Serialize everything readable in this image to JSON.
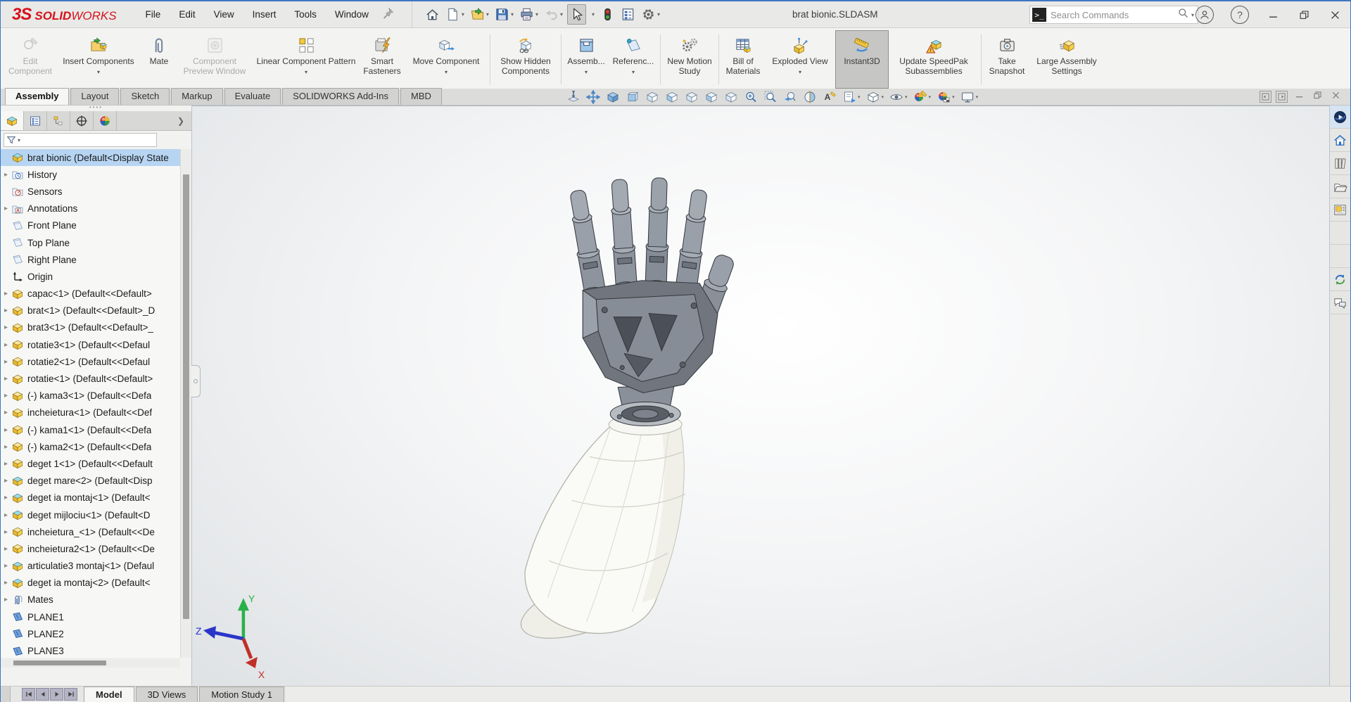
{
  "window": {
    "logo": "3S",
    "brand_bold": "SOLID",
    "brand_rest": "WORKS",
    "title": "brat bionic.SLDASM"
  },
  "menu": {
    "items": [
      "File",
      "Edit",
      "View",
      "Insert",
      "Tools",
      "Window"
    ]
  },
  "search": {
    "placeholder": "Search Commands"
  },
  "ribbon": {
    "buttons": [
      {
        "label": "Edit Component"
      },
      {
        "label": "Insert Components"
      },
      {
        "label": "Mate"
      },
      {
        "label": "Component Preview Window"
      },
      {
        "label": "Linear Component Pattern"
      },
      {
        "label": "Smart Fasteners"
      },
      {
        "label": "Move Component"
      },
      {
        "label": "Show Hidden Components"
      },
      {
        "label": "Assemb..."
      },
      {
        "label": "Referenc..."
      },
      {
        "label": "New Motion Study"
      },
      {
        "label": "Bill of Materials"
      },
      {
        "label": "Exploded View"
      },
      {
        "label": "Instant3D"
      },
      {
        "label": "Update SpeedPak Subassemblies"
      },
      {
        "label": "Take Snapshot"
      },
      {
        "label": "Large Assembly Settings"
      }
    ]
  },
  "tabs": {
    "items": [
      {
        "label": "Assembly",
        "active": true,
        "name": "tab-assembly"
      },
      {
        "label": "Layout",
        "name": "tab-layout"
      },
      {
        "label": "Sketch",
        "name": "tab-sketch"
      },
      {
        "label": "Markup",
        "name": "tab-markup"
      },
      {
        "label": "Evaluate",
        "name": "tab-evaluate"
      },
      {
        "label": "SOLIDWORKS Add-Ins",
        "name": "tab-solidworks-add-ins"
      },
      {
        "label": "MBD",
        "name": "tab-mbd"
      }
    ]
  },
  "hud": {
    "items": [
      {
        "name": "zoom-to-fit-button",
        "icon": "hud-fit"
      },
      {
        "name": "pan-button",
        "icon": "hud-pan"
      },
      {
        "name": "view-isometric-button",
        "icon": "hud-cube-solid"
      },
      {
        "name": "view-front-button",
        "icon": "hud-cube-front"
      },
      {
        "name": "view-back-button",
        "icon": "hud-cube"
      },
      {
        "name": "view-left-button",
        "icon": "hud-cube-left"
      },
      {
        "name": "view-right-button",
        "icon": "hud-cube"
      },
      {
        "name": "view-top-button",
        "icon": "hud-cube-left"
      },
      {
        "name": "view-bottom-button",
        "icon": "hud-cube"
      },
      {
        "name": "zoom-to-area-button",
        "icon": "hud-zoom-area"
      },
      {
        "name": "zoom-in-out-button",
        "icon": "hud-zoom"
      },
      {
        "name": "previous-view-button",
        "icon": "hud-prev"
      },
      {
        "name": "section-view-button",
        "icon": "hud-section"
      },
      {
        "name": "annotation-visibility-button",
        "icon": "hud-anno"
      },
      {
        "name": "view-orientation-button",
        "icon": "hud-sheet",
        "caret": true
      },
      {
        "name": "display-style-button",
        "icon": "hud-cube-outline",
        "caret": true
      },
      {
        "name": "hide-show-items-button",
        "icon": "hud-eye",
        "caret": true
      },
      {
        "name": "edit-appearance-button",
        "icon": "hud-ball-pencil",
        "caret": true
      },
      {
        "name": "apply-scene-button",
        "icon": "hud-ball-scene",
        "caret": true
      },
      {
        "name": "view-settings-button",
        "icon": "hud-monitor",
        "caret": true
      }
    ]
  },
  "tree": {
    "items": [
      {
        "label": "brat bionic  (Default<Display State",
        "icon": "i-asm",
        "selected": true,
        "name": "tree-item-root"
      },
      {
        "label": "History",
        "icon": "i-folder-history",
        "arrow": true
      },
      {
        "label": "Sensors",
        "icon": "i-folder-sensors"
      },
      {
        "label": "Annotations",
        "icon": "i-folder-annotations",
        "arrow": true
      },
      {
        "label": "Front Plane",
        "icon": "i-plane"
      },
      {
        "label": "Top Plane",
        "icon": "i-plane"
      },
      {
        "label": "Right Plane",
        "icon": "i-plane"
      },
      {
        "label": "Origin",
        "icon": "i-origin"
      },
      {
        "label": "capac<1> (Default<<Default>",
        "icon": "i-part",
        "arrow": true
      },
      {
        "label": "brat<1> (Default<<Default>_D",
        "icon": "i-part",
        "arrow": true
      },
      {
        "label": "brat3<1> (Default<<Default>_",
        "icon": "i-part",
        "arrow": true
      },
      {
        "label": "rotatie3<1> (Default<<Defaul",
        "icon": "i-part",
        "arrow": true
      },
      {
        "label": "rotatie2<1> (Default<<Defaul",
        "icon": "i-part",
        "arrow": true
      },
      {
        "label": "rotatie<1> (Default<<Default>",
        "icon": "i-part",
        "arrow": true
      },
      {
        "label": "(-) kama3<1> (Default<<Defa",
        "icon": "i-part",
        "arrow": true
      },
      {
        "label": "incheietura<1> (Default<<Def",
        "icon": "i-part",
        "arrow": true
      },
      {
        "label": "(-) kama1<1> (Default<<Defa",
        "icon": "i-part",
        "arrow": true
      },
      {
        "label": "(-) kama2<1> (Default<<Defa",
        "icon": "i-part",
        "arrow": true
      },
      {
        "label": "deget 1<1> (Default<<Default",
        "icon": "i-part",
        "arrow": true
      },
      {
        "label": "deget mare<2> (Default<Disp",
        "icon": "i-asm",
        "arrow": true
      },
      {
        "label": "deget ia montaj<1> (Default<",
        "icon": "i-asm",
        "arrow": true
      },
      {
        "label": "deget mijlociu<1> (Default<D",
        "icon": "i-asm",
        "arrow": true
      },
      {
        "label": "incheietura_<1> (Default<<De",
        "icon": "i-part",
        "arrow": true
      },
      {
        "label": "incheietura2<1> (Default<<De",
        "icon": "i-part",
        "arrow": true
      },
      {
        "label": "articulatie3 montaj<1> (Defaul",
        "icon": "i-asm",
        "arrow": true
      },
      {
        "label": "deget ia montaj<2> (Default<",
        "icon": "i-asm",
        "arrow": true
      },
      {
        "label": "Mates",
        "icon": "i-mates",
        "arrow": true
      },
      {
        "label": "PLANE1",
        "icon": "i-plane2"
      },
      {
        "label": "PLANE2",
        "icon": "i-plane2"
      },
      {
        "label": "PLANE3",
        "icon": "i-plane2"
      }
    ]
  },
  "taskpane": {
    "items": [
      {
        "name": "3dexperience-button",
        "icon": "tp-3dexp",
        "active": true
      },
      {
        "name": "home-button",
        "icon": "tp-home"
      },
      {
        "name": "design-library-button",
        "icon": "tp-library"
      },
      {
        "name": "file-explorer-button",
        "icon": "tp-folder"
      },
      {
        "name": "view-palette-button",
        "icon": "tp-palette"
      },
      {
        "name": "appearances-scenes-button",
        "icon": "tp-ball"
      },
      {
        "name": "custom-properties-button",
        "icon": "tp-props"
      },
      {
        "name": "solidworks-resources-button",
        "icon": "tp-refresh"
      },
      {
        "name": "comments-button",
        "icon": "tp-comments"
      }
    ]
  },
  "bottom": {
    "tabs": [
      {
        "label": "Model",
        "active": true,
        "name": "bottom-tab-model"
      },
      {
        "label": "3D Views",
        "name": "bottom-tab-3d-views"
      },
      {
        "label": "Motion Study 1",
        "name": "bottom-tab-motion-study-1"
      }
    ]
  },
  "triad": {
    "x": "X",
    "y": "Y",
    "z": "Z"
  },
  "colors": {
    "selection": "#b7d5f2",
    "brand_red": "#d6121b",
    "triad_x": "#c03026",
    "triad_y": "#2ab04a",
    "triad_z": "#2a36c8",
    "part_yellow": "#f2c93f"
  }
}
